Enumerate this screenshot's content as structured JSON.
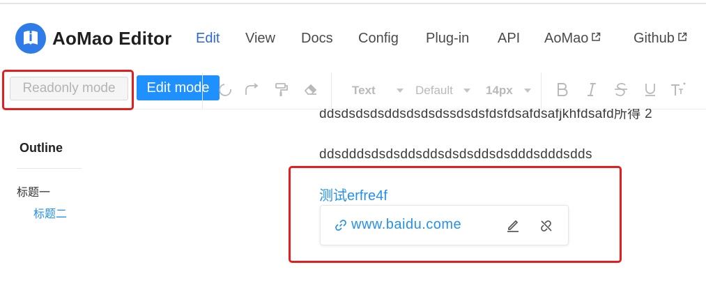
{
  "header": {
    "brand": "AoMao Editor",
    "nav": [
      {
        "label": "Edit",
        "active": true
      },
      {
        "label": "View"
      },
      {
        "label": "Docs"
      },
      {
        "label": "Config"
      },
      {
        "label": "Plug-in"
      },
      {
        "label": "API"
      },
      {
        "label": "AoMao",
        "external": true
      },
      {
        "label": "Github",
        "external": true
      }
    ]
  },
  "toolbar": {
    "readonly_label": "Readonly mode",
    "edit_label": "Edit mode",
    "heading_select": "Text",
    "font_select": "Default",
    "size_select": "14px",
    "icons": [
      "undo-icon",
      "redo-icon",
      "format-painter-icon",
      "clear-format-icon",
      "bold-icon",
      "italic-icon",
      "strikethrough-icon",
      "underline-icon",
      "font-style-icon"
    ]
  },
  "outline": {
    "title": "Outline",
    "items": [
      {
        "label": "标题一",
        "level": 1,
        "active": false
      },
      {
        "label": "标题二",
        "level": 2,
        "active": true
      }
    ]
  },
  "content": {
    "line1": "ddsdsdsdsddsdsdsdssdsdsfdsfdsafdsafjkhfdsafd所得 2",
    "line2": "ddsdddsdsdsddsddsdsdsddsdsdddsdddsdds",
    "link_text": "测试erfre4f",
    "popover": {
      "url": "www.baidu.come",
      "edit_icon": "edit-icon",
      "unlink_icon": "unlink-icon"
    }
  },
  "colors": {
    "accent": "#1e90ff",
    "link": "#2490ef",
    "nav_active": "#2d69d6",
    "highlight_border": "#e41d1d"
  }
}
